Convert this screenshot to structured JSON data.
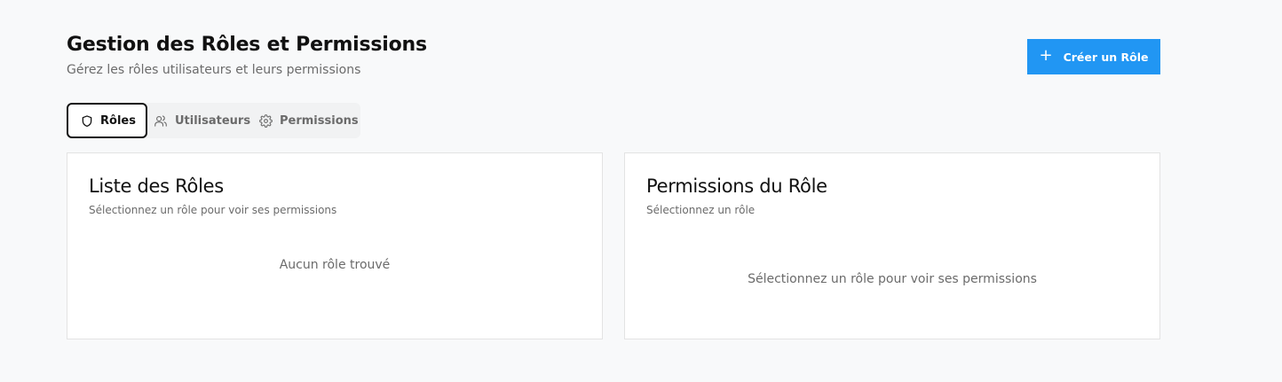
{
  "header": {
    "title": "Gestion des Rôles et Permissions",
    "subtitle": "Gérez les rôles utilisateurs et leurs permissions",
    "create_button_label": "Créer un Rôle"
  },
  "tabs": [
    {
      "label": "Rôles",
      "icon": "shield-icon",
      "active": true
    },
    {
      "label": "Utilisateurs",
      "icon": "users-icon",
      "active": false
    },
    {
      "label": "Permissions",
      "icon": "gear-icon",
      "active": false
    }
  ],
  "roles_card": {
    "title": "Liste des Rôles",
    "subtitle": "Sélectionnez un rôle pour voir ses permissions",
    "empty_text": "Aucun rôle trouvé"
  },
  "permissions_card": {
    "title": "Permissions du Rôle",
    "subtitle": "Sélectionnez un rôle",
    "empty_text": "Sélectionnez un rôle pour voir ses permissions"
  },
  "colors": {
    "accent": "#2196f3",
    "background": "#f8f9fa",
    "muted_text": "#6b6b6b"
  }
}
